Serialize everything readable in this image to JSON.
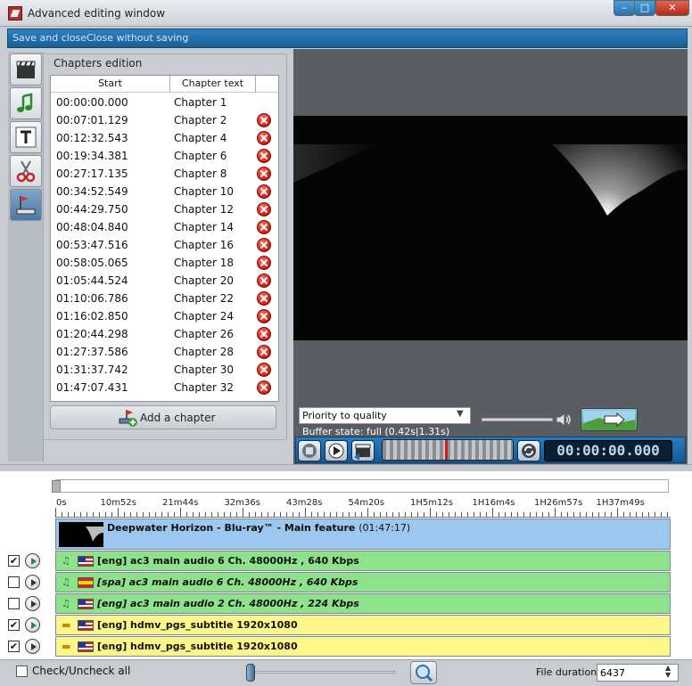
{
  "window": {
    "title": "Advanced editing window"
  },
  "menu": {
    "save_and_close": "Save and close",
    "close_without_saving": "Close without saving"
  },
  "chapters": {
    "group_title": "Chapters edition",
    "columns": {
      "start": "Start",
      "text": "Chapter text"
    },
    "rows": [
      {
        "start": "00:00:00.000",
        "text": "Chapter 1"
      },
      {
        "start": "00:07:01.129",
        "text": "Chapter 2"
      },
      {
        "start": "00:12:32.543",
        "text": "Chapter 4"
      },
      {
        "start": "00:19:34.381",
        "text": "Chapter 6"
      },
      {
        "start": "00:27:17.135",
        "text": "Chapter 8"
      },
      {
        "start": "00:34:52.549",
        "text": "Chapter 10"
      },
      {
        "start": "00:44:29.750",
        "text": "Chapter 12"
      },
      {
        "start": "00:48:04.840",
        "text": "Chapter 14"
      },
      {
        "start": "00:53:47.516",
        "text": "Chapter 16"
      },
      {
        "start": "00:58:05.065",
        "text": "Chapter 18"
      },
      {
        "start": "01:05:44.524",
        "text": "Chapter 20"
      },
      {
        "start": "01:10:06.786",
        "text": "Chapter 22"
      },
      {
        "start": "01:16:02.850",
        "text": "Chapter 24"
      },
      {
        "start": "01:20:44.298",
        "text": "Chapter 26"
      },
      {
        "start": "01:27:37.586",
        "text": "Chapter 28"
      },
      {
        "start": "01:31:37.742",
        "text": "Chapter 30"
      },
      {
        "start": "01:47:07.431",
        "text": "Chapter 32"
      }
    ],
    "add_button": "Add a chapter"
  },
  "player": {
    "priority": "Priority to quality",
    "buffer_state": "Buffer state: full (0.42s|1.31s)",
    "time": "00:00:00.000"
  },
  "timeline": {
    "ruler": [
      "0s",
      "10m52s",
      "21m44s",
      "32m36s",
      "43m28s",
      "54m20s",
      "1H5m12s",
      "1H16m4s",
      "1H26m57s",
      "1H37m49s"
    ],
    "video": {
      "title": "Deepwater Horizon - Blu-ray™ - Main feature",
      "duration": "(01:47:17)"
    },
    "tracks": [
      {
        "label": "[eng] ac3 main audio 6 Ch. 48000Hz , 640 Kbps",
        "kind": "audio",
        "flag": "us",
        "checked": true,
        "playing": true,
        "italic": false
      },
      {
        "label": "[spa] ac3 main audio 6 Ch. 48000Hz , 640 Kbps",
        "kind": "audio",
        "flag": "es",
        "checked": false,
        "playing": false,
        "italic": true
      },
      {
        "label": "[eng] ac3 main audio 2 Ch. 48000Hz , 224 Kbps",
        "kind": "audio",
        "flag": "us",
        "checked": false,
        "playing": false,
        "italic": true
      },
      {
        "label": "[eng] hdmv_pgs_subtitle 1920x1080",
        "kind": "subtitle",
        "flag": "us",
        "checked": true,
        "playing": true,
        "italic": false
      },
      {
        "label": "[eng] hdmv_pgs_subtitle 1920x1080",
        "kind": "subtitle",
        "flag": "us",
        "checked": true,
        "playing": false,
        "italic": false
      }
    ]
  },
  "footer": {
    "check_all": "Check/Uncheck all",
    "file_duration_label": "File duration:",
    "file_duration_value": "6437"
  },
  "colors": {
    "audio_track": "#8ee28c",
    "subtitle_track": "#fdf68a",
    "video_track": "#9cc8ef",
    "delete": "#c41b10"
  }
}
